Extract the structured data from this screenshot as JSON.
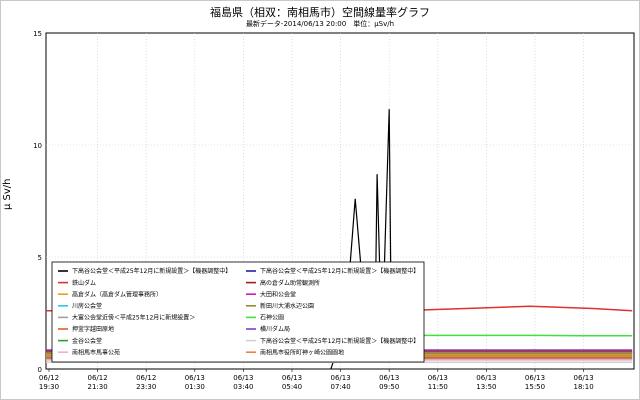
{
  "chart_data": {
    "type": "line",
    "title": "福島県（相双：南相馬市）空間線量率グラフ",
    "subtitle": "最新データ-2014/06/13 20:00　単位：μSv/h",
    "ylabel": "μ Sv/h",
    "ylim": [
      0,
      15
    ],
    "yticks": [
      "0",
      "5",
      "10",
      "15"
    ],
    "grid": true,
    "legend_position": "lower-left, over plot",
    "xticks": [
      {
        "date": "06/12",
        "time": "19:30"
      },
      {
        "date": "06/12",
        "time": "21:30"
      },
      {
        "date": "06/12",
        "time": "23:30"
      },
      {
        "date": "06/13",
        "time": "01:30"
      },
      {
        "date": "06/13",
        "time": "03:40"
      },
      {
        "date": "06/13",
        "time": "05:40"
      },
      {
        "date": "06/13",
        "time": "07:40"
      },
      {
        "date": "06/13",
        "time": "09:50"
      },
      {
        "date": "06/13",
        "time": "11:50"
      },
      {
        "date": "06/13",
        "time": "13:50"
      },
      {
        "date": "06/13",
        "time": "15:50"
      },
      {
        "date": "06/13",
        "time": "18:10"
      }
    ],
    "series": [
      {
        "name": "下高谷公会堂＜平成25年12月に新規設置＞【機器調整中】",
        "color": "#000000",
        "points": [
          [
            5.8,
            0
          ],
          [
            6.1,
            2.0
          ],
          [
            6.3,
            7.6
          ],
          [
            6.55,
            1.2
          ],
          [
            6.7,
            0.4
          ],
          [
            6.75,
            8.7
          ],
          [
            6.85,
            1.0
          ],
          [
            7.0,
            11.6
          ],
          [
            7.05,
            0.3
          ]
        ]
      },
      {
        "name": "鉄山ダム",
        "color": "#e03030",
        "points": [
          [
            -0.2,
            2.6
          ],
          [
            2.0,
            2.6
          ],
          [
            4.0,
            2.6
          ],
          [
            5.9,
            2.6
          ],
          [
            7.5,
            2.62
          ],
          [
            8.8,
            2.72
          ],
          [
            9.9,
            2.8
          ],
          [
            11.2,
            2.7
          ],
          [
            12.0,
            2.6
          ]
        ]
      },
      {
        "name": "高倉ダム（高倉ダム管理事務所）",
        "color": "#e8a020",
        "points": [
          [
            -0.2,
            0.65
          ],
          [
            3.0,
            0.65
          ],
          [
            6.0,
            0.65
          ],
          [
            9.0,
            0.65
          ],
          [
            12.0,
            0.65
          ]
        ]
      },
      {
        "name": "川房公会堂",
        "color": "#30c8e8",
        "points": [
          [
            -0.2,
            0.55
          ],
          [
            3.0,
            0.55
          ],
          [
            6.0,
            0.55
          ],
          [
            9.0,
            0.55
          ],
          [
            12.0,
            0.55
          ]
        ]
      },
      {
        "name": "大富公会堂近傍＜平成25年12月に新規設置＞",
        "color": "#a0a0a0",
        "points": [
          [
            -0.2,
            0.45
          ],
          [
            3.0,
            0.45
          ],
          [
            6.0,
            0.45
          ],
          [
            9.0,
            0.45
          ],
          [
            12.0,
            0.45
          ]
        ]
      },
      {
        "name": "押釜字越田原地",
        "color": "#e06020",
        "points": [
          [
            -0.2,
            0.5
          ],
          [
            3.0,
            0.5
          ],
          [
            6.0,
            0.5
          ],
          [
            9.0,
            0.5
          ],
          [
            12.0,
            0.5
          ]
        ]
      },
      {
        "name": "金谷公会堂",
        "color": "#30a030",
        "points": [
          [
            -0.2,
            0.6
          ],
          [
            3.0,
            0.6
          ],
          [
            6.0,
            0.6
          ],
          [
            9.0,
            0.6
          ],
          [
            12.0,
            0.6
          ]
        ]
      },
      {
        "name": "南相馬市馬事公苑",
        "color": "#f0b0c8",
        "points": [
          [
            -0.2,
            0.4
          ],
          [
            3.0,
            0.4
          ],
          [
            6.0,
            0.4
          ],
          [
            9.0,
            0.4
          ],
          [
            12.0,
            0.4
          ]
        ]
      },
      {
        "name": "下高谷公会堂＜平成25年12月に新規設置＞【機器調整中】",
        "color": "#2020a0",
        "points": [
          [
            6.9,
            0.35
          ],
          [
            7.2,
            0.35
          ],
          [
            7.4,
            0.35
          ]
        ]
      },
      {
        "name": "高の倉ダム助常観測所",
        "color": "#a02020",
        "points": [
          [
            -0.2,
            0.8
          ],
          [
            3.0,
            0.8
          ],
          [
            6.0,
            0.8
          ],
          [
            9.0,
            0.8
          ],
          [
            12.0,
            0.8
          ]
        ]
      },
      {
        "name": "大田和公会堂",
        "color": "#c020c0",
        "points": [
          [
            -0.2,
            0.72
          ],
          [
            3.0,
            0.72
          ],
          [
            6.0,
            0.72
          ],
          [
            9.0,
            0.72
          ],
          [
            12.0,
            0.72
          ]
        ]
      },
      {
        "name": "新田川大浦水辺公園",
        "color": "#909020",
        "points": [
          [
            -0.2,
            0.7
          ],
          [
            3.0,
            0.7
          ],
          [
            6.0,
            0.7
          ],
          [
            9.0,
            0.7
          ],
          [
            12.0,
            0.7
          ]
        ]
      },
      {
        "name": "石神公園",
        "color": "#40e040",
        "points": [
          [
            7.5,
            1.5
          ],
          [
            8.8,
            1.5
          ],
          [
            10.0,
            1.5
          ],
          [
            11.0,
            1.48
          ],
          [
            12.0,
            1.48
          ]
        ]
      },
      {
        "name": "横川ダム局",
        "color": "#8040c0",
        "points": [
          [
            -0.2,
            0.85
          ],
          [
            3.0,
            0.85
          ],
          [
            6.0,
            0.85
          ],
          [
            9.0,
            0.85
          ],
          [
            12.0,
            0.85
          ]
        ]
      },
      {
        "name": "下高谷公会堂＜平成25年12月に新規設置＞【機器調整中】",
        "color": "#d0d0d0",
        "points": [
          [
            -0.2,
            0.3
          ],
          [
            6.0,
            0.3
          ],
          [
            12.0,
            0.3
          ]
        ]
      },
      {
        "name": "南相馬市役所町神ヶ崎公園園地",
        "color": "#f08040",
        "points": [
          [
            -0.2,
            0.58
          ],
          [
            3.0,
            0.58
          ],
          [
            6.0,
            0.58
          ],
          [
            9.0,
            0.58
          ],
          [
            12.0,
            0.58
          ]
        ]
      }
    ]
  }
}
